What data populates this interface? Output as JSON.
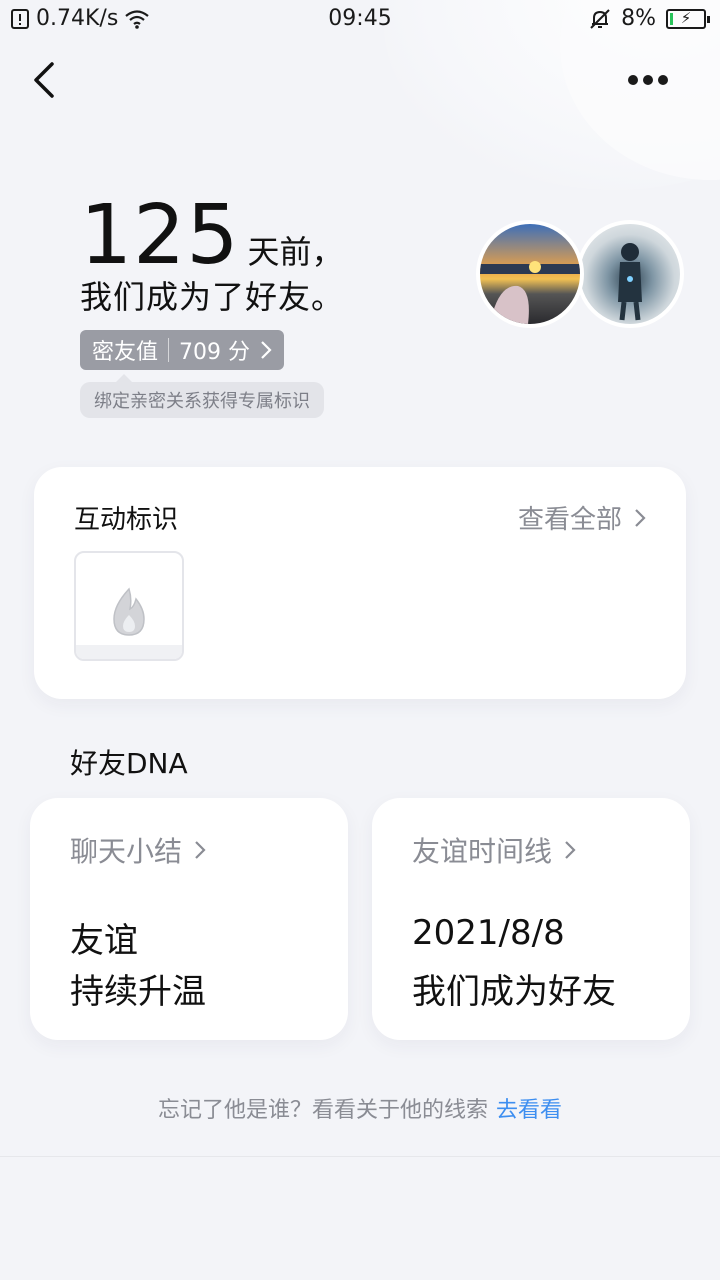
{
  "status_bar": {
    "net_speed": "0.74K/s",
    "time": "09:45",
    "battery": "8%",
    "battery_level": 0.08,
    "icons": [
      "data-saver-icon",
      "wifi-icon",
      "mute-bell-icon",
      "battery-charging-icon"
    ]
  },
  "nav": {
    "back_icon": "chevron-left-icon",
    "more_icon": "more-dots-icon"
  },
  "header": {
    "days_number": "125",
    "days_suffix": "天前，",
    "subtitle": "我们成为了好友。",
    "score_label": "密友值",
    "score_value": "709 分",
    "hint": "绑定亲密关系获得专属标识"
  },
  "interaction": {
    "title": "互动标识",
    "view_all": "查看全部",
    "badge_icon": "flame-icon"
  },
  "dna": {
    "title": "好友DNA",
    "cards": [
      {
        "head": "聊天小结",
        "line1": "友谊",
        "line2": "持续升温"
      },
      {
        "head": "友谊时间线",
        "line1": "2021/8/8",
        "line2": "我们成为好友"
      }
    ]
  },
  "footer": {
    "text": "忘记了他是谁？看看关于他的线索",
    "link": "去看看"
  },
  "colors": {
    "background": "#f3f4f8",
    "link": "#3d8ef0",
    "muted_text": "#8a8c94",
    "pill_bg": "#9a9ca4"
  }
}
